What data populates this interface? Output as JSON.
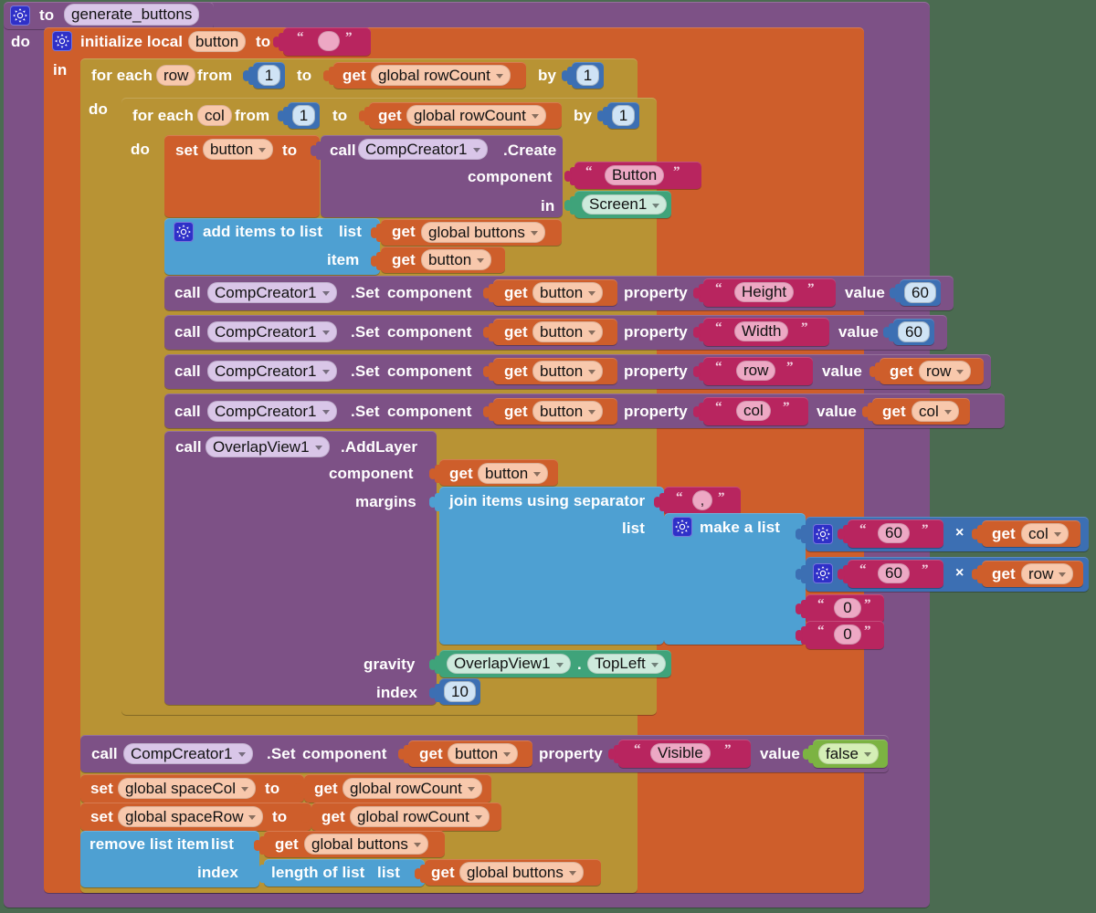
{
  "procedure": {
    "keyword_to": "to",
    "name": "generate_buttons",
    "keyword_do": "do",
    "gear_icon": "gear-icon"
  },
  "local": {
    "label": "initialize local",
    "var_name": "button",
    "keyword_to": "to",
    "keyword_in": "in",
    "init_value": "",
    "gear_icon": "gear-icon"
  },
  "loops": [
    {
      "label": "for each",
      "var": "row",
      "from_label": "from",
      "from_value": "1",
      "to_label": "to",
      "to_get": "get",
      "to_var": "global rowCount",
      "by_label": "by",
      "by_value": "1",
      "do_label": "do"
    },
    {
      "label": "for each",
      "var": "col",
      "from_label": "from",
      "from_value": "1",
      "to_label": "to",
      "to_get": "get",
      "to_var": "global rowCount",
      "by_label": "by",
      "by_value": "1",
      "do_label": "do"
    }
  ],
  "set_button": {
    "set_label": "set",
    "var": "button",
    "to_label": "to"
  },
  "create_call": {
    "call_label": "call",
    "component": "CompCreator1",
    "method": ".Create",
    "arg1_label": "component",
    "arg1_value": "Button",
    "arg2_label": "in",
    "arg2_value": "Screen1"
  },
  "add_items": {
    "label": "add items to list",
    "list_label": "list",
    "list_get": "get",
    "list_var": "global buttons",
    "item_label": "item",
    "item_get": "get",
    "item_var": "button",
    "gear_icon": "gear-icon"
  },
  "set_calls": [
    {
      "call_label": "call",
      "component": "CompCreator1",
      "method": ".Set",
      "component_label": "component",
      "component_get": "get",
      "component_var": "button",
      "property_label": "property",
      "property_value": "Height",
      "value_label": "value",
      "value_type": "number",
      "value": "60"
    },
    {
      "call_label": "call",
      "component": "CompCreator1",
      "method": ".Set",
      "component_label": "component",
      "component_get": "get",
      "component_var": "button",
      "property_label": "property",
      "property_value": "Width",
      "value_label": "value",
      "value_type": "number",
      "value": "60"
    },
    {
      "call_label": "call",
      "component": "CompCreator1",
      "method": ".Set",
      "component_label": "component",
      "component_get": "get",
      "component_var": "button",
      "property_label": "property",
      "property_value": "row",
      "value_label": "value",
      "value_type": "get",
      "value_get": "get",
      "value": "row"
    },
    {
      "call_label": "call",
      "component": "CompCreator1",
      "method": ".Set",
      "component_label": "component",
      "component_get": "get",
      "component_var": "button",
      "property_label": "property",
      "property_value": "col",
      "value_label": "value",
      "value_type": "get",
      "value_get": "get",
      "value": "col"
    }
  ],
  "addlayer": {
    "call_label": "call",
    "component": "OverlapView1",
    "method": ".AddLayer",
    "component_label": "component",
    "component_get": "get",
    "component_var": "button",
    "margins_label": "margins",
    "join_label": "join items using separator",
    "separator": ",",
    "list_label": "list",
    "make_list_label": "make a list",
    "make_list_gear": "gear-icon",
    "items": [
      {
        "type": "multiply",
        "left": "60",
        "op": "×",
        "right_get": "get",
        "right_var": "col",
        "gear_icon": "gear-icon"
      },
      {
        "type": "multiply",
        "left": "60",
        "op": "×",
        "right_get": "get",
        "right_var": "row",
        "gear_icon": "gear-icon"
      },
      {
        "type": "text",
        "value": "0"
      },
      {
        "type": "text",
        "value": "0"
      }
    ],
    "gravity_label": "gravity",
    "gravity_component": "OverlapView1",
    "gravity_dot": ".",
    "gravity_value": "TopLeft",
    "index_label": "index",
    "index_value": "10"
  },
  "set_visible": {
    "call_label": "call",
    "component": "CompCreator1",
    "method": ".Set",
    "component_label": "component",
    "component_get": "get",
    "component_var": "button",
    "property_label": "property",
    "property_value": "Visible",
    "value_label": "value",
    "value": "false"
  },
  "set_globals": [
    {
      "set_label": "set",
      "var": "global spaceCol",
      "to_label": "to",
      "get_label": "get",
      "get_var": "global rowCount"
    },
    {
      "set_label": "set",
      "var": "global spaceRow",
      "to_label": "to",
      "get_label": "get",
      "get_var": "global rowCount"
    }
  ],
  "remove_item": {
    "label": "remove list item",
    "list_label": "list",
    "list_get": "get",
    "list_var": "global buttons",
    "index_label": "index",
    "length_label": "length of list",
    "length_list_label": "list",
    "length_get": "get",
    "length_var": "global buttons"
  },
  "colors": {
    "background": "#4b6b51",
    "procedure": "#7d5186",
    "control": "#b89334",
    "variable": "#ce5e2b",
    "list": "#4e9fd1",
    "text": "#b8255f",
    "math": "#3c6fb3",
    "component": "#3fa37a",
    "logic": "#7cb342"
  }
}
